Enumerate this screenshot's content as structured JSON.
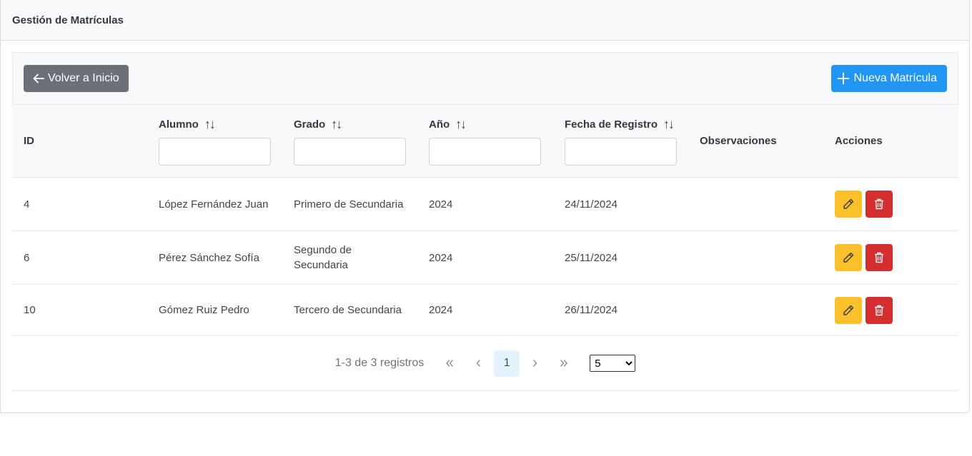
{
  "header": {
    "title": "Gestión de Matrículas"
  },
  "toolbar": {
    "back_label": "Volver a Inicio",
    "new_label": "Nueva Matrícula"
  },
  "table": {
    "columns": {
      "id": "ID",
      "alumno": "Alumno",
      "grado": "Grado",
      "anio": "Año",
      "fecha": "Fecha de Registro",
      "observaciones": "Observaciones",
      "acciones": "Acciones"
    },
    "filters": {
      "alumno": "",
      "grado": "",
      "anio": "",
      "fecha": ""
    },
    "rows": [
      {
        "id": "4",
        "alumno": "López Fernández Juan",
        "grado": "Primero de Secundaria",
        "anio": "2024",
        "fecha": "24/11/2024",
        "observaciones": ""
      },
      {
        "id": "6",
        "alumno": "Pérez Sánchez Sofía",
        "grado": "Segundo de Secundaria",
        "anio": "2024",
        "fecha": "25/11/2024",
        "observaciones": ""
      },
      {
        "id": "10",
        "alumno": "Gómez Ruiz Pedro",
        "grado": "Tercero de Secundaria",
        "anio": "2024",
        "fecha": "26/11/2024",
        "observaciones": ""
      }
    ]
  },
  "paginator": {
    "report": "1-3 de 3 registros",
    "first": "«",
    "prev": "‹",
    "current_page": "1",
    "next": "›",
    "last": "»",
    "rows_per_page": "5"
  },
  "icons": {
    "back": "arrow-left-icon",
    "new": "plus-icon",
    "sort": "sort-icon",
    "edit": "pencil-icon",
    "delete": "trash-icon"
  },
  "colors": {
    "back_button": "#6b7177",
    "new_button": "#2196f3",
    "edit_button": "#fbc12d",
    "delete_button": "#d32f2f",
    "active_page": "#e3f2fd"
  }
}
